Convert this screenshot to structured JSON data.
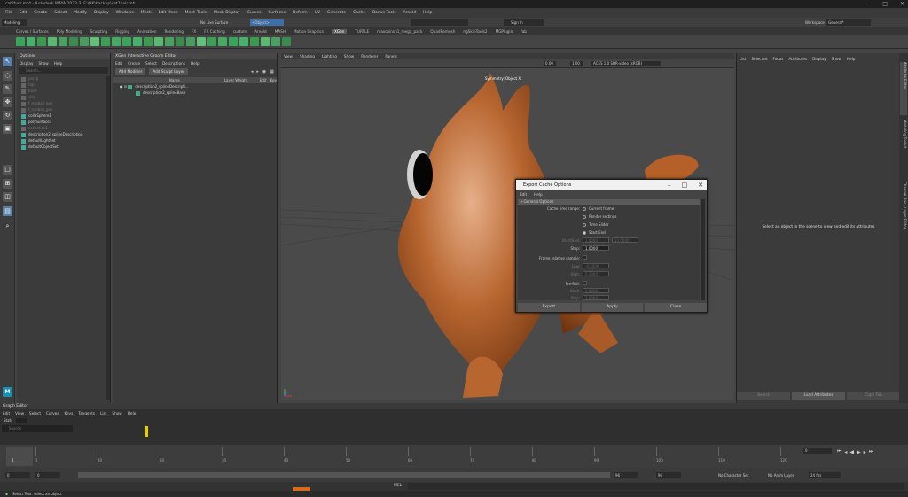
{
  "window": {
    "title": "cat2hair.mb* - Autodesk MAYA 2023.3: E:\\NK\\backup\\cat2hair.mb"
  },
  "menubar": [
    "File",
    "Edit",
    "Create",
    "Select",
    "Modify",
    "Display",
    "Windows",
    "Mesh",
    "Edit Mesh",
    "Mesh Tools",
    "Mesh Display",
    "Curves",
    "Surfaces",
    "Deform",
    "UV",
    "Generate",
    "Cache",
    "Bonus Tools",
    "Arnold",
    "Help"
  ],
  "statusline": {
    "mode": "Modeling",
    "live_surface": "No Live Surface",
    "object_field": "<Object>",
    "signin": "Sign In",
    "workspace_label": "Workspace :",
    "workspace": "General*"
  },
  "shelf_tabs": [
    "Curves / Surfaces",
    "Poly Modeling",
    "Sculpting",
    "Rigging",
    "Animation",
    "Rendering",
    "FX",
    "FX Caching",
    "custom",
    "Arnold",
    "MASH",
    "Motion Graphics",
    "XGen",
    "TURTLE",
    "maxcoinsh1_mega_pack",
    "QuadRemesh",
    "ngSkinTools2",
    "MGPlugin",
    "fab"
  ],
  "shelf_active": "XGen",
  "outliner": {
    "title": "Outliner",
    "menu": [
      "Display",
      "Show",
      "Help"
    ],
    "search_placeholder": "Search...",
    "items": [
      {
        "label": "persp",
        "dim": true
      },
      {
        "label": "top",
        "dim": true
      },
      {
        "label": "front",
        "dim": true
      },
      {
        "label": "side",
        "dim": true
      },
      {
        "label": "f_eyeball_geo",
        "dim": true
      },
      {
        "label": "f_eyeball_geo",
        "dim": true
      },
      {
        "label": "collaSphere1",
        "dim": false
      },
      {
        "label": "polySurface1",
        "dim": false
      },
      {
        "label": "collection1",
        "dim": true
      },
      {
        "label": "description2_splineDescription",
        "dim": false
      },
      {
        "label": "defaultLightSet",
        "dim": false
      },
      {
        "label": "defaultObjectSet",
        "dim": false
      }
    ]
  },
  "xgen": {
    "title": "XGen Interactive Groom Editor",
    "menu": [
      "Edit",
      "Create",
      "Select",
      "Descriptions",
      "Help"
    ],
    "add_modifier": "Add Modifier",
    "add_sculpt": "Add Sculpt Layer",
    "columns": [
      "Name",
      "Layer Weight",
      "Edit",
      "Key"
    ],
    "tree": [
      "description2_splineDescripti...",
      "description2_splineBase"
    ]
  },
  "viewport": {
    "menu": [
      "View",
      "Shading",
      "Lighting",
      "Show",
      "Renderer",
      "Panels"
    ],
    "exposure": "0.00",
    "gamma": "1.00",
    "colorspace": "ACES 1.0 SDR-video (sRGB)",
    "symmetry": "Symmetry: Object X"
  },
  "attribute_editor": {
    "menu": [
      "List",
      "Selected",
      "Focus",
      "Attributes",
      "Display",
      "Show",
      "Help"
    ],
    "empty_msg": "Select an object in the scene to view and edit its attributes",
    "buttons": [
      "Select",
      "Load Attributes",
      "Copy Tab"
    ],
    "side_tabs": [
      "Attribute Editor",
      "Modeling Toolkit",
      "Channel Box / Layer Editor"
    ]
  },
  "dialog": {
    "title": "Export Cache Options",
    "menu": [
      "Edit",
      "Help"
    ],
    "section": "General Options",
    "cache_time_range_label": "Cache time range:",
    "radios": [
      "Current frame",
      "Render settings",
      "Time Slider",
      "Start/End"
    ],
    "selected_radio": "Start/End",
    "start_end_label": "Start/End:",
    "start_val": "1.0000",
    "end_val": "10.0000",
    "step_label": "Step:",
    "step_val": "1.0000",
    "frame_relative_label": "Frame relative sample:",
    "low_label": "Low:",
    "low_val": "-0.2000",
    "high_label": "High:",
    "high_val": "0.2000",
    "preroll_label": "Pre-Roll:",
    "prestart_label": "Start:",
    "prestart_val": "0.0000",
    "prestep_label": "Step:",
    "prestep_val": "1.0000",
    "buttons": [
      "Export",
      "Apply",
      "Close"
    ]
  },
  "graph_editor": {
    "title": "Graph Editor",
    "menu": [
      "Edit",
      "View",
      "Select",
      "Curves",
      "Keys",
      "Tangents",
      "List",
      "Show",
      "Help"
    ],
    "stats_label": "Stats",
    "stats_placeholder": "Search"
  },
  "timeline": {
    "ticks": [
      "1",
      "10",
      "20",
      "30",
      "40",
      "50",
      "60",
      "70",
      "80",
      "90",
      "100",
      "110",
      "120"
    ],
    "current": "1",
    "current_frame_field": "0"
  },
  "range": {
    "start": "0",
    "start_inner": "0",
    "end_inner": "96",
    "end": "96",
    "char_set": "No Character Set",
    "anim_layer": "No Anim Layer",
    "fps": "24 fps"
  },
  "cmdline": {
    "label": "MEL"
  },
  "helpline": {
    "text": "Select Tool: select an object"
  }
}
